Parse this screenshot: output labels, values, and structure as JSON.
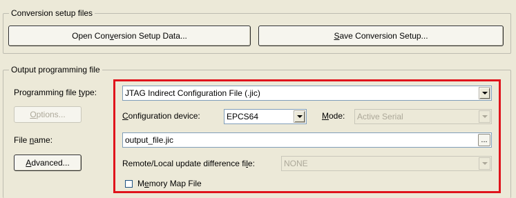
{
  "conversion_group": {
    "title": "Conversion setup files",
    "open_button": {
      "pre": "Open Con",
      "ul": "v",
      "post": "ersion Setup Data..."
    },
    "save_button": {
      "pre": "",
      "ul": "S",
      "post": "ave Conversion Setup..."
    }
  },
  "output_group": {
    "title": "Output programming file",
    "file_type_label": {
      "pre": "Programming file ",
      "ul": "t",
      "post": "ype:"
    },
    "file_type_value": "JTAG Indirect Configuration File (.jic)",
    "options_button": {
      "pre": "",
      "ul": "O",
      "post": "ptions..."
    },
    "config_device_label": {
      "pre": "",
      "ul": "C",
      "post": "onfiguration device:"
    },
    "config_device_value": "EPCS64",
    "mode_label": {
      "pre": "",
      "ul": "M",
      "post": "ode:"
    },
    "mode_value": "Active Serial",
    "file_name_label": {
      "pre": "File ",
      "ul": "n",
      "post": "ame:"
    },
    "file_name_value": "output_file.jic",
    "browse_label": "...",
    "advanced_button": {
      "pre": "",
      "ul": "A",
      "post": "dvanced..."
    },
    "remote_label": {
      "pre": "Remote/Local update difference fi",
      "ul": "l",
      "post": "e:"
    },
    "remote_value": "NONE",
    "memory_map_label": {
      "pre": "M",
      "ul": "e",
      "post": "mory Map File"
    },
    "memory_map_checked": false
  },
  "colors": {
    "highlight": "#e0141c",
    "dialog_bg": "#ece9d8",
    "field_border": "#7f9db9"
  }
}
